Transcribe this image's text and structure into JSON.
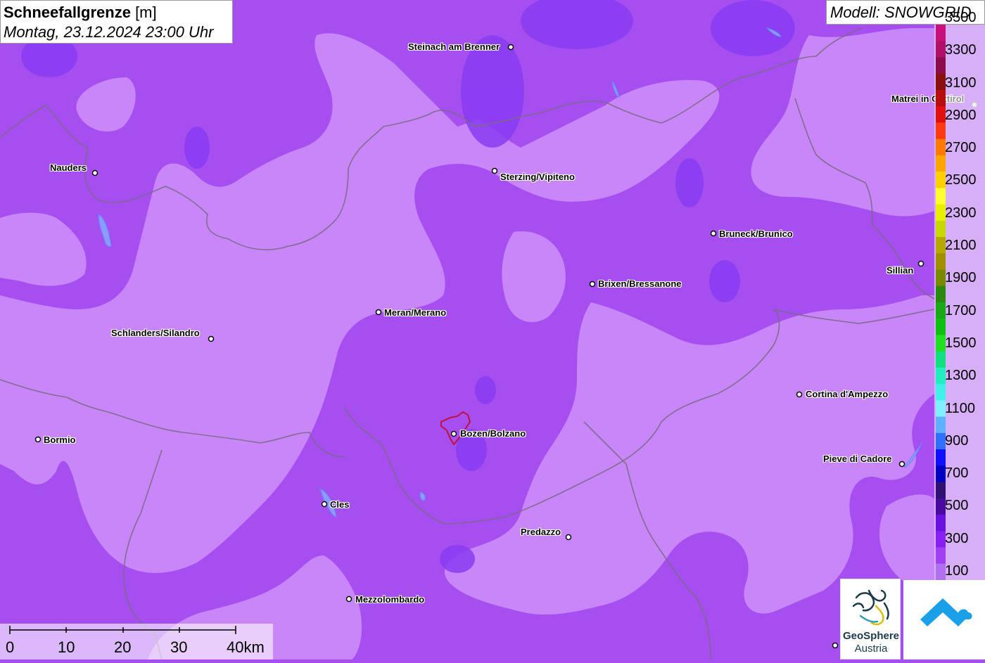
{
  "header": {
    "title_bold": "Schneefallgrenze",
    "title_unit": " [m]",
    "datetime": "Montag, 23.12.2024 23:00 Uhr",
    "model": "Modell: SNOWGRID"
  },
  "legend": {
    "labels": [
      "3500",
      "3300",
      "3100",
      "2900",
      "2700",
      "2500",
      "2300",
      "2100",
      "1900",
      "1700",
      "1500",
      "1300",
      "1100",
      "900",
      "700",
      "500",
      "300",
      "100"
    ],
    "colors": [
      "#c8107a",
      "#b0106a",
      "#8c0b4c",
      "#8a0f0f",
      "#b80d0d",
      "#e01010",
      "#ff3a10",
      "#ff7a00",
      "#ffa500",
      "#ffd000",
      "#ffff30",
      "#e6f000",
      "#c8d800",
      "#b5a800",
      "#a09000",
      "#7a8a00",
      "#2a8a10",
      "#18a818",
      "#10c010",
      "#20e020",
      "#10e080",
      "#20f0c0",
      "#40f0e8",
      "#80f0ff",
      "#60b0ff",
      "#3070ff",
      "#1010ff",
      "#0000c0",
      "#301070",
      "#4a0aa0",
      "#6a10e0",
      "#8a20f0",
      "#a040f0",
      "#b070f0"
    ]
  },
  "palette": {
    "light_zone": "#c886f8",
    "dark_zone": "#a64ef0",
    "pocket_zone": "#8a3cf2",
    "border": "#7a6a8a",
    "water": "#8a9cff"
  },
  "places": [
    {
      "name": "Steinach am Brenner",
      "side": "left"
    },
    {
      "name": "Nauders",
      "side": "left"
    },
    {
      "name": "Sterzing/Vipiteno",
      "side": "right"
    },
    {
      "name": "Matrei in Osttirol",
      "side": "left"
    },
    {
      "name": "Bruneck/Brunico",
      "side": "right"
    },
    {
      "name": "Sillian",
      "side": "left"
    },
    {
      "name": "Brixen/Bressanone",
      "side": "right"
    },
    {
      "name": "Meran/Merano",
      "side": "right"
    },
    {
      "name": "Schlanders/Silandro",
      "side": "left"
    },
    {
      "name": "Cortina d'Ampezzo",
      "side": "right"
    },
    {
      "name": "Bormio",
      "side": "right"
    },
    {
      "name": "Bozen/Bolzano",
      "side": "right"
    },
    {
      "name": "Pieve di Cadore",
      "side": "left"
    },
    {
      "name": "Cles",
      "side": "right"
    },
    {
      "name": "Predazzo",
      "side": "left"
    },
    {
      "name": "Mezzolombardo",
      "side": "right"
    }
  ],
  "scale": {
    "labels": [
      "0",
      "10",
      "20",
      "30",
      "40km"
    ]
  },
  "logos": {
    "geosphere_line1": "GeoSphere",
    "geosphere_line2": "Austria"
  }
}
